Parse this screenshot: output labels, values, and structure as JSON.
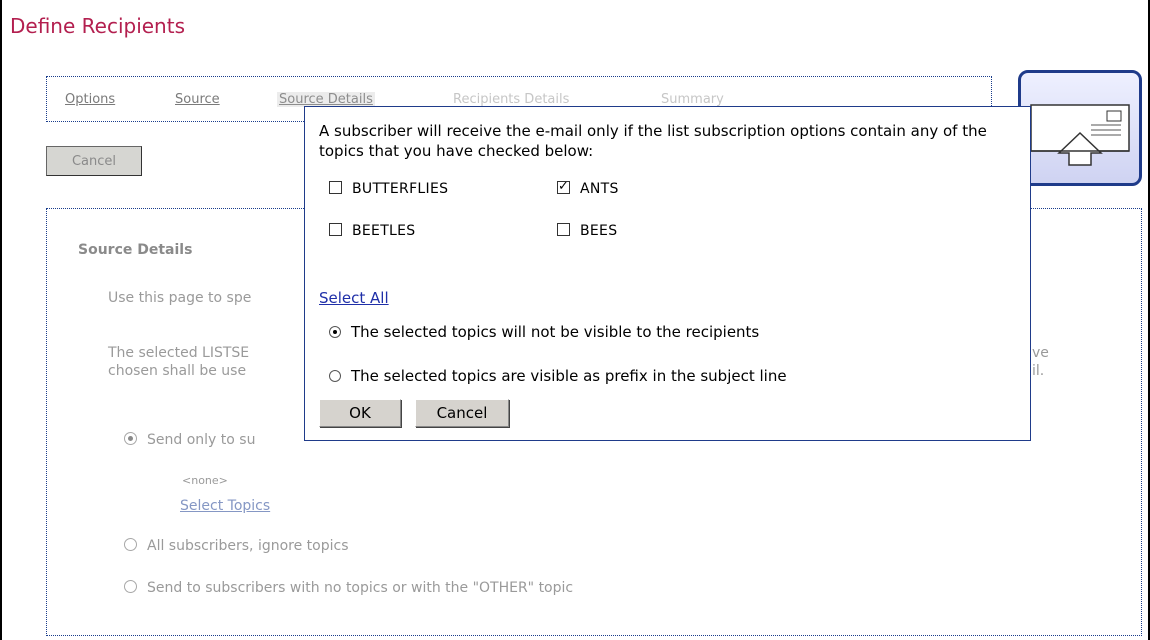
{
  "page": {
    "title": "Define Recipients"
  },
  "tabs": [
    {
      "label": "Options",
      "state": "link"
    },
    {
      "label": "Source",
      "state": "link"
    },
    {
      "label": "Source Details",
      "state": "active"
    },
    {
      "label": "Recipients Details",
      "state": "disabled"
    },
    {
      "label": "Summary",
      "state": "disabled"
    }
  ],
  "toolbar": {
    "cancel_label": "Cancel"
  },
  "content": {
    "section_title": "Source Details",
    "desc_line1": "Use this page to spe",
    "desc_line2a": "The selected LISTSE",
    "desc_line2b": "chosen shall be use",
    "desc_right1": "ve",
    "desc_right2": "il.",
    "radio_send_only": "Send only to su",
    "none_text": "<none>",
    "select_topics": "Select Topics",
    "radio_all": "All subscribers, ignore topics",
    "radio_no_topics": "Send to subscribers with no topics or with the \"OTHER\" topic"
  },
  "modal": {
    "intro": "A subscriber will receive the e-mail only if the list subscription options contain any of the topics that you have checked below:",
    "topics": [
      {
        "label": "BUTTERFLIES",
        "checked": false
      },
      {
        "label": "ANTS",
        "checked": true
      },
      {
        "label": "BEETLES",
        "checked": false
      },
      {
        "label": "BEES",
        "checked": false
      }
    ],
    "select_all": "Select All",
    "visibility_options": [
      {
        "label": "The selected topics will not be visible to the recipients",
        "selected": true
      },
      {
        "label": "The selected topics are visible as prefix in the subject line",
        "selected": false
      }
    ],
    "ok_label": "OK",
    "cancel_label": "Cancel"
  },
  "colors": {
    "title": "#b31f4f",
    "border_accent": "#1f3b8a",
    "link": "#1f2fa8"
  },
  "icons": {
    "logo": "envelope-arrow-icon"
  }
}
